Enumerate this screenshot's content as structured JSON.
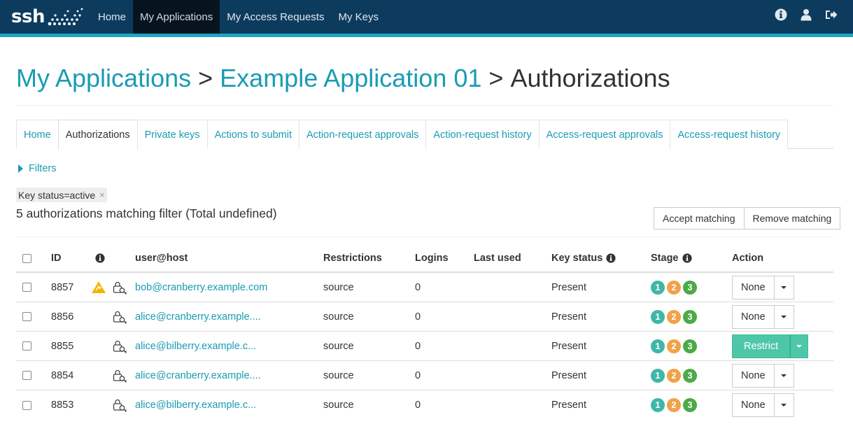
{
  "brand": {
    "name": "ssh"
  },
  "nav": {
    "items": [
      {
        "label": "Home",
        "active": false
      },
      {
        "label": "My Applications",
        "active": true
      },
      {
        "label": "My Access Requests",
        "active": false
      },
      {
        "label": "My Keys",
        "active": false
      }
    ],
    "icons": [
      "info-icon",
      "user-icon",
      "logout-icon"
    ]
  },
  "heading": {
    "crumb1": "My Applications",
    "sep": ">",
    "crumb2": "Example Application 01",
    "current": "Authorizations"
  },
  "tabs": [
    {
      "label": "Home",
      "active": false
    },
    {
      "label": "Authorizations",
      "active": true
    },
    {
      "label": "Private keys",
      "active": false
    },
    {
      "label": "Actions to submit",
      "active": false
    },
    {
      "label": "Action-request approvals",
      "active": false
    },
    {
      "label": "Action-request history",
      "active": false
    },
    {
      "label": "Access-request approvals",
      "active": false
    },
    {
      "label": "Access-request history",
      "active": false
    }
  ],
  "filters": {
    "toggle_label": "Filters",
    "chip_label": "Key status=active",
    "chip_remove": "×"
  },
  "summary": "5 authorizations matching filter (Total undefined)",
  "buttons": {
    "accept": "Accept matching",
    "remove": "Remove matching"
  },
  "table": {
    "headers": {
      "id": "ID",
      "user_host": "user@host",
      "restrictions": "Restrictions",
      "logins": "Logins",
      "last_used": "Last used",
      "key_status": "Key status",
      "stage": "Stage",
      "action": "Action"
    },
    "rows": [
      {
        "id": "8857",
        "warning": true,
        "user_host": "bob@cranberry.example.com",
        "restrictions": "source",
        "logins": "0",
        "last_used": "",
        "key_status": "Present",
        "stage": [
          "1",
          "2",
          "3"
        ],
        "action": "None",
        "action_style": "default"
      },
      {
        "id": "8856",
        "warning": false,
        "user_host": "alice@cranberry.example....",
        "restrictions": "source",
        "logins": "0",
        "last_used": "",
        "key_status": "Present",
        "stage": [
          "1",
          "2",
          "3"
        ],
        "action": "None",
        "action_style": "default"
      },
      {
        "id": "8855",
        "warning": false,
        "user_host": "alice@bilberry.example.c...",
        "restrictions": "source",
        "logins": "0",
        "last_used": "",
        "key_status": "Present",
        "stage": [
          "1",
          "2",
          "3"
        ],
        "action": "Restrict",
        "action_style": "success"
      },
      {
        "id": "8854",
        "warning": false,
        "user_host": "alice@cranberry.example....",
        "restrictions": "source",
        "logins": "0",
        "last_used": "",
        "key_status": "Present",
        "stage": [
          "1",
          "2",
          "3"
        ],
        "action": "None",
        "action_style": "default"
      },
      {
        "id": "8853",
        "warning": false,
        "user_host": "alice@bilberry.example.c...",
        "restrictions": "source",
        "logins": "0",
        "last_used": "",
        "key_status": "Present",
        "stage": [
          "1",
          "2",
          "3"
        ],
        "action": "None",
        "action_style": "default"
      }
    ]
  },
  "colors": {
    "navbar": "#0d3b5e",
    "accent_stripe": "#1aa7c6",
    "link": "#1a9bb4",
    "stage1": "#3fb7a8",
    "stage2": "#f0a24a",
    "stage3": "#4caa48",
    "success_button": "#4ec6a8",
    "warning": "#f5b400"
  }
}
